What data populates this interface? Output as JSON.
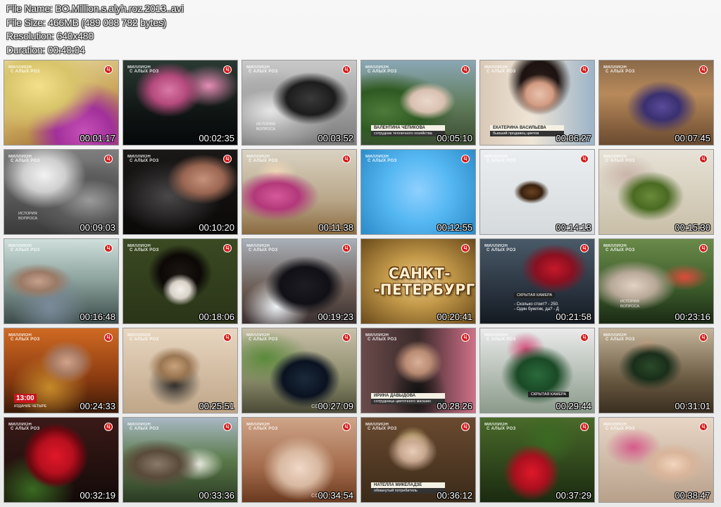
{
  "meta": {
    "file_name": "File Name: BO.Million.s.alyh.roz.2013..avi",
    "file_size": "File Size: 466MB (489 008 782 bytes)",
    "resolution": "Resolution: 640x480",
    "duration": "Duration: 00:40:04"
  },
  "thumbnails": [
    {
      "time": "00:01:17"
    },
    {
      "time": "00:02:35"
    },
    {
      "time": "00:03:52"
    },
    {
      "time": "00:05:10",
      "caption_name": "ВАЛЕНТИНА ЧЕПИКОВА",
      "caption_role": "сотрудник тепличного хозяйства"
    },
    {
      "time": "00:06:27",
      "caption_name": "ЕКАТЕРИНА ВАСИЛЬЕВА",
      "caption_role": "бывший продавец цветов"
    },
    {
      "time": "00:07:45"
    },
    {
      "time": "00:09:03"
    },
    {
      "time": "00:10:20"
    },
    {
      "time": "00:11:38"
    },
    {
      "time": "00:12:55"
    },
    {
      "time": "00:14:13"
    },
    {
      "time": "00:15:30"
    },
    {
      "time": "00:16:48"
    },
    {
      "time": "00:18:06"
    },
    {
      "time": "00:19:23"
    },
    {
      "time": "00:20:41",
      "city": "САНКТ- -ПЕТЕРБУРГ"
    },
    {
      "time": "00:21:58",
      "hidden_cam": "СКРЫТАЯ КАМЕРА",
      "subtitle_1": "- Сколько стоит? - 250.",
      "subtitle_2": "- Один букетик, да? - Д"
    },
    {
      "time": "00:23:16"
    },
    {
      "time": "00:24:33",
      "clock_badge": "13:00",
      "clock_sub": "ИЗДАНИЕ ЧЕТЫРЕ"
    },
    {
      "time": "00:25:51"
    },
    {
      "time": "00:27:09",
      "watermark": "СОВ"
    },
    {
      "time": "00:28:26",
      "caption_name": "ИРИНА ДАВЫДОВА",
      "caption_role": "сотрудница цветочного магазин"
    },
    {
      "time": "00:29:44",
      "hidden_cam": "СКРЫТАЯ КАМЕРА"
    },
    {
      "time": "00:31:01"
    },
    {
      "time": "00:32:19"
    },
    {
      "time": "00:33:36"
    },
    {
      "time": "00:34:54",
      "watermark": "СОВ"
    },
    {
      "time": "00:36:12",
      "caption_name": "НАТЕЛЛА МИКЕЛАДЗЕ",
      "caption_role": "обманутый потребитель"
    },
    {
      "time": "00:37:29"
    },
    {
      "time": "00:38:47"
    }
  ],
  "logo_lines": [
    "МИЛЛИОН",
    "С АЛЫХ РОЗ"
  ],
  "channel_badge": "Ц",
  "tagline_lines": [
    "ИСТОРИЯ",
    "ВОПРОСА"
  ]
}
